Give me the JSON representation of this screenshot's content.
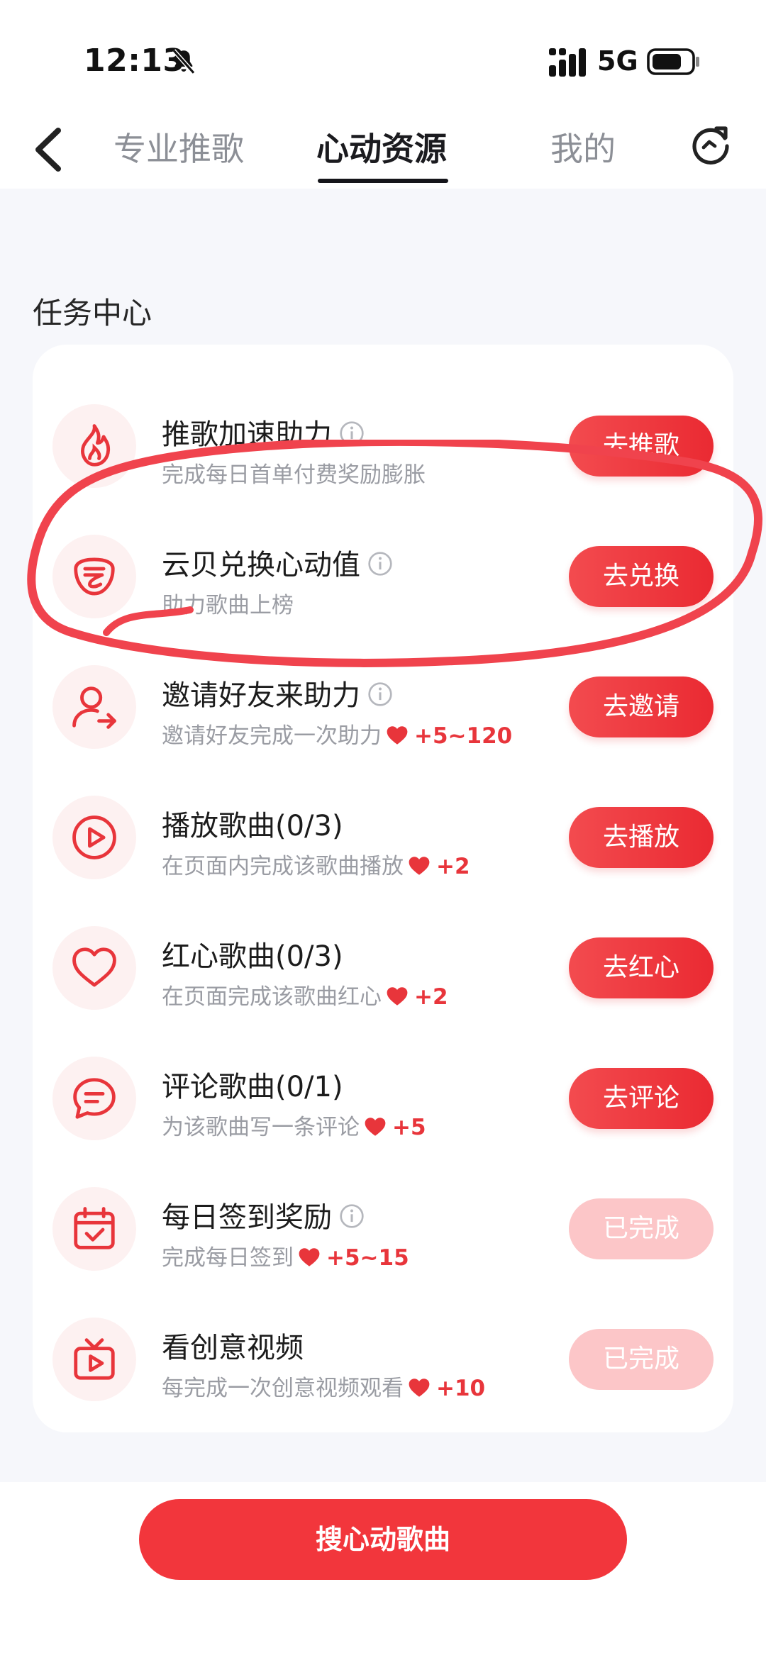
{
  "status_bar": {
    "time": "12:13",
    "network": "5G"
  },
  "nav": {
    "tabs": [
      {
        "label": "专业推歌",
        "active": false
      },
      {
        "label": "心动资源",
        "active": true
      },
      {
        "label": "我的",
        "active": false
      }
    ]
  },
  "section": {
    "title": "任务中心"
  },
  "tasks": [
    {
      "title": "推歌加速助力",
      "desc": "完成每日首单付费奖励膨胀",
      "reward": "",
      "button": "去推歌",
      "done": false,
      "icon": "flame-icon"
    },
    {
      "title": "云贝兑换心动值",
      "desc": "助力歌曲上榜",
      "reward": "",
      "button": "去兑换",
      "done": false,
      "icon": "cloud-coin-icon"
    },
    {
      "title": "邀请好友来助力",
      "desc": "邀请好友完成一次助力",
      "reward": "+5~120",
      "button": "去邀请",
      "done": false,
      "icon": "invite-user-icon"
    },
    {
      "title": "播放歌曲(0/3)",
      "desc": "在页面内完成该歌曲播放",
      "reward": "+2",
      "button": "去播放",
      "done": false,
      "icon": "play-icon"
    },
    {
      "title": "红心歌曲(0/3)",
      "desc": "在页面完成该歌曲红心",
      "reward": "+2",
      "button": "去红心",
      "done": false,
      "icon": "heart-icon"
    },
    {
      "title": "评论歌曲(0/1)",
      "desc": "为该歌曲写一条评论",
      "reward": "+5",
      "button": "去评论",
      "done": false,
      "icon": "comment-icon"
    },
    {
      "title": "每日签到奖励",
      "desc": "完成每日签到",
      "reward": "+5~15",
      "button": "已完成",
      "done": true,
      "icon": "calendar-check-icon"
    },
    {
      "title": "看创意视频",
      "desc": "每完成一次创意视频观看",
      "reward": "+10",
      "button": "已完成",
      "done": true,
      "icon": "tv-play-icon"
    }
  ],
  "bottom": {
    "button_label": "搜心动歌曲"
  },
  "colors": {
    "accent": "#ea2a32",
    "done_button": "#fcc6c8",
    "icon_bg": "#fdf1f1"
  }
}
